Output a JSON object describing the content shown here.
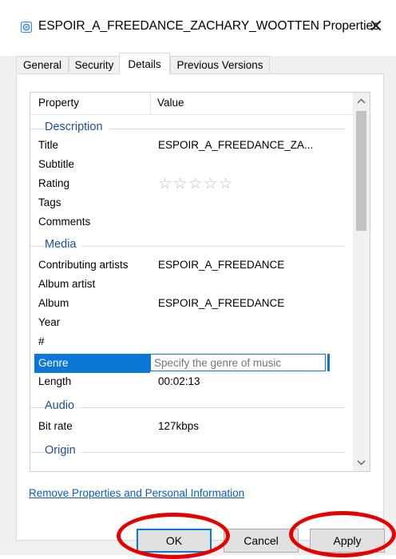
{
  "window": {
    "title": "ESPOIR_A_FREEDANCE_ZACHARY_WOOTTEN Properties",
    "close_glyph": "✕",
    "icon": "audio-file-icon"
  },
  "tabs": [
    {
      "label": "General",
      "active": false
    },
    {
      "label": "Security",
      "active": false
    },
    {
      "label": "Details",
      "active": true
    },
    {
      "label": "Previous Versions",
      "active": false
    }
  ],
  "columns": {
    "property": "Property",
    "value": "Value"
  },
  "groups": {
    "description": "Description",
    "media": "Media",
    "audio": "Audio",
    "origin": "Origin"
  },
  "rows": {
    "title": {
      "property": "Title",
      "value": "ESPOIR_A_FREEDANCE_ZA..."
    },
    "subtitle": {
      "property": "Subtitle",
      "value": ""
    },
    "rating": {
      "property": "Rating",
      "value": "☆☆☆☆☆",
      "stars": 0
    },
    "tags": {
      "property": "Tags",
      "value": ""
    },
    "comments": {
      "property": "Comments",
      "value": ""
    },
    "contributing_artists": {
      "property": "Contributing artists",
      "value": "ESPOIR_A_FREEDANCE"
    },
    "album_artist": {
      "property": "Album artist",
      "value": ""
    },
    "album": {
      "property": "Album",
      "value": "ESPOIR_A_FREEDANCE"
    },
    "year": {
      "property": "Year",
      "value": ""
    },
    "number": {
      "property": "#",
      "value": ""
    },
    "genre": {
      "property": "Genre",
      "placeholder": "Specify the genre of music",
      "value": ""
    },
    "length": {
      "property": "Length",
      "value": "00:02:13"
    },
    "bit_rate": {
      "property": "Bit rate",
      "value": "127kbps"
    }
  },
  "scroll": {
    "up_glyph": "^",
    "down_glyph": "⌄"
  },
  "remove_link": "Remove Properties and Personal Information",
  "buttons": {
    "ok": "OK",
    "cancel": "Cancel",
    "apply": "Apply"
  },
  "colors": {
    "accent": "#0b78d7",
    "group_header": "#1e4e9a",
    "link": "#0b5db8",
    "annotation": "#e60000"
  }
}
